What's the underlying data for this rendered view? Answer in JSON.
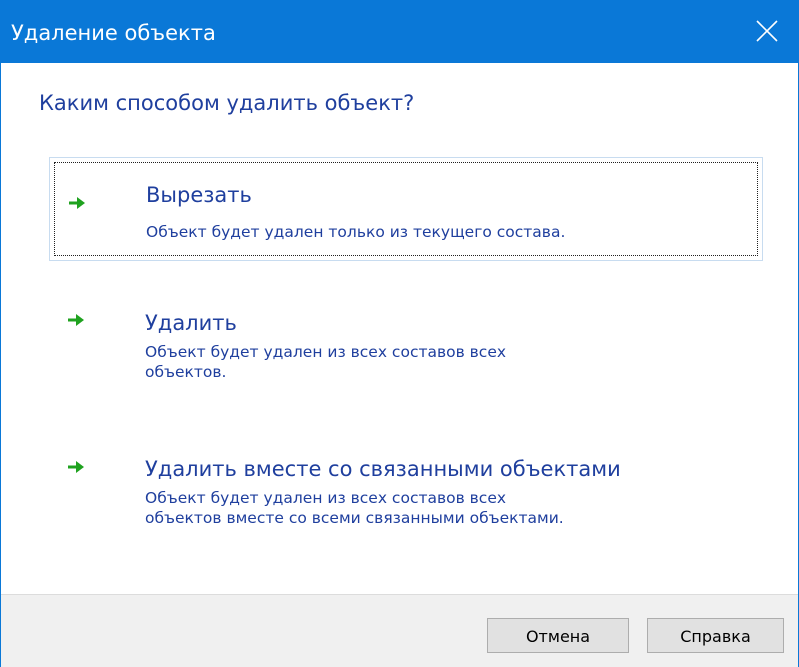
{
  "window": {
    "title": "Удаление объекта",
    "close_icon": "close-icon",
    "accent_color": "#0a78d7"
  },
  "question": "Каким способом удалить объект?",
  "options": [
    {
      "icon": "green-arrow-right-icon",
      "title": "Вырезать",
      "desc_lines": [
        "Объект будет удален только из текущего состава."
      ],
      "focused": true
    },
    {
      "icon": "green-arrow-right-icon",
      "title": "Удалить",
      "desc_lines": [
        "Объект будет удален из всех составов всех",
        "объектов."
      ],
      "focused": false
    },
    {
      "icon": "green-arrow-right-icon",
      "title": "Удалить вместе со связанными объектами",
      "desc_lines": [
        "Объект будет удален из всех составов всех",
        "объектов вместе со всеми связанными объектами."
      ],
      "focused": false
    }
  ],
  "footer": {
    "cancel_label": "Отмена",
    "help_label": "Справка"
  },
  "colors": {
    "text_blue": "#1f3f9e",
    "arrow_green": "#1fa21f"
  }
}
